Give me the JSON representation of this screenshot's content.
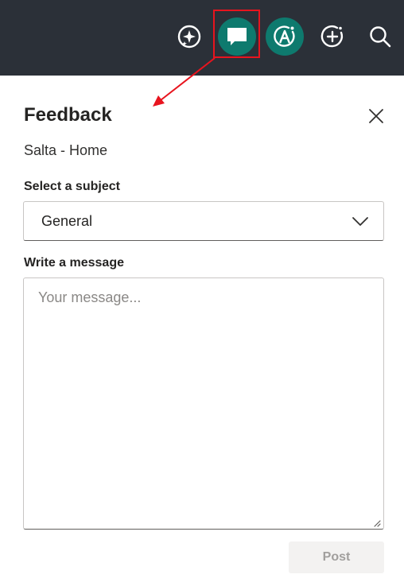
{
  "topbar": {
    "icons": [
      {
        "name": "copilot-sparkle-icon"
      },
      {
        "name": "feedback-icon",
        "active": true,
        "accent": "#0e7a6e"
      },
      {
        "name": "accessibility-check-icon",
        "accent": "#0e7a6e"
      },
      {
        "name": "add-icon"
      },
      {
        "name": "search-icon"
      }
    ],
    "background": "#2b3038"
  },
  "annotation": {
    "highlight_color": "#e8141e",
    "target": "feedback-icon"
  },
  "panel": {
    "title": "Feedback",
    "context": "Salta - Home",
    "subject": {
      "label": "Select a subject",
      "selected": "General"
    },
    "message": {
      "label": "Write a message",
      "placeholder": "Your message...",
      "value": ""
    },
    "post_label": "Post"
  }
}
